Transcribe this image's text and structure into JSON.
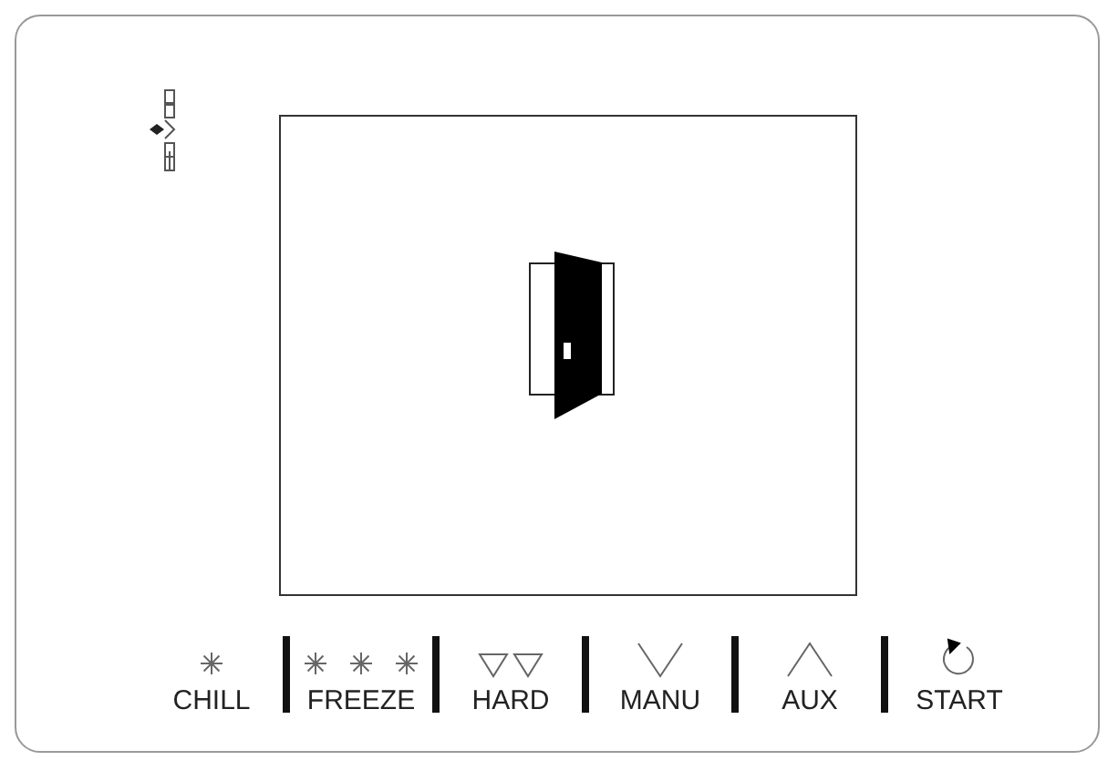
{
  "buttons": [
    {
      "label": "CHILL",
      "kind": "chill"
    },
    {
      "label": "FREEZE",
      "kind": "freeze"
    },
    {
      "label": "HARD",
      "kind": "hard"
    },
    {
      "label": "MANU",
      "kind": "manu"
    },
    {
      "label": "AUX",
      "kind": "aux"
    },
    {
      "label": "START",
      "kind": "start"
    }
  ]
}
